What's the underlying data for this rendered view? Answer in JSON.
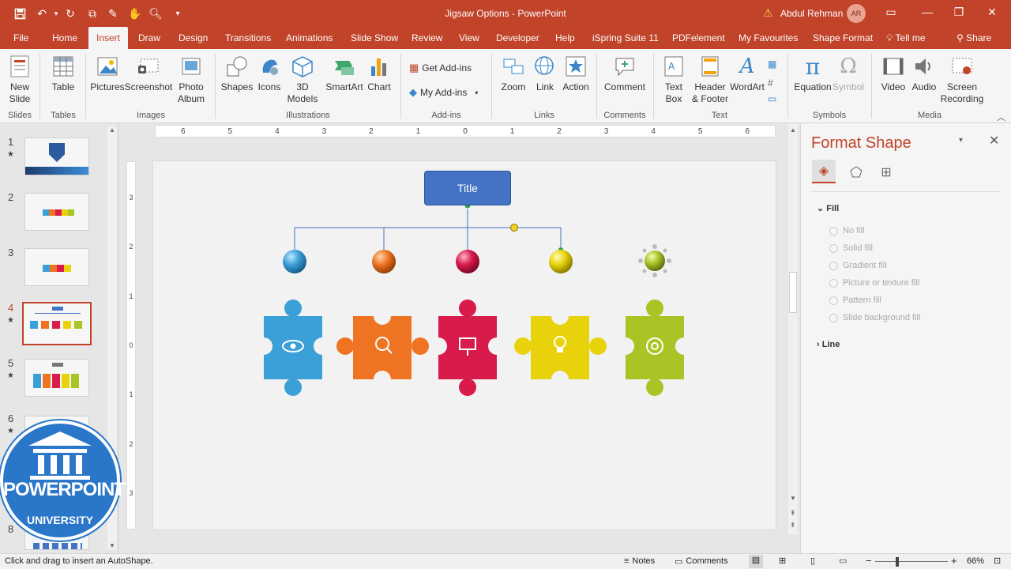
{
  "titlebar": {
    "title": "Jigsaw Options  -  PowerPoint",
    "user_name": "Abdul Rehman",
    "user_initials": "AR"
  },
  "tabs": [
    "File",
    "Home",
    "Insert",
    "Draw",
    "Design",
    "Transitions",
    "Animations",
    "Slide Show",
    "Review",
    "View",
    "Developer",
    "Help",
    "iSpring Suite 11",
    "PDFelement",
    "My Favourites",
    "Shape Format",
    "Tell me",
    "Share"
  ],
  "active_tab": "Insert",
  "ribbon": {
    "new_slide": "New\nSlide",
    "table": "Table",
    "pictures": "Pictures",
    "screenshot": "Screenshot",
    "photo_album": "Photo\nAlbum",
    "shapes": "Shapes",
    "icons": "Icons",
    "models": "3D\nModels",
    "smartart": "SmartArt",
    "chart": "Chart",
    "get_addins": "Get Add-ins",
    "my_addins": "My Add-ins",
    "zoom": "Zoom",
    "link": "Link",
    "action": "Action",
    "comment": "Comment",
    "text_box": "Text\nBox",
    "header_footer": "Header\n& Footer",
    "wordart": "WordArt",
    "equation": "Equation",
    "symbol": "Symbol",
    "video": "Video",
    "audio": "Audio",
    "screen_recording": "Screen\nRecording",
    "groups": {
      "slides": "Slides",
      "tables": "Tables",
      "images": "Images",
      "illustrations": "Illustrations",
      "addins": "Add-ins",
      "links": "Links",
      "comments": "Comments",
      "text": "Text",
      "symbols": "Symbols",
      "media": "Media"
    }
  },
  "thumbnails": [
    "1",
    "2",
    "3",
    "4",
    "5",
    "6",
    "8"
  ],
  "selected_slide": "4",
  "slide": {
    "title_box": "Title",
    "colors": {
      "blue": "#3b9fd8",
      "orange": "#ee7423",
      "red": "#d81b4b",
      "yellow": "#e8d20b",
      "green": "#a9c425",
      "title": "#4472c4"
    }
  },
  "ruler_ticks": [
    "6",
    "5",
    "4",
    "3",
    "2",
    "1",
    "0",
    "1",
    "2",
    "3",
    "4",
    "5",
    "6"
  ],
  "vruler_ticks": [
    "3",
    "2",
    "1",
    "0",
    "1",
    "2",
    "3"
  ],
  "format_pane": {
    "title": "Format Shape",
    "fill_header": "Fill",
    "fill_options": [
      "No fill",
      "Solid fill",
      "Gradient fill",
      "Picture or texture fill",
      "Pattern fill",
      "Slide background fill"
    ],
    "line_header": "Line"
  },
  "logo": {
    "line1": "POWERPOINT",
    "line2": "UNIVERSITY"
  },
  "status": {
    "message": "Click and drag to insert an AutoShape.",
    "notes": "Notes",
    "comments": "Comments",
    "zoom": "66%"
  }
}
